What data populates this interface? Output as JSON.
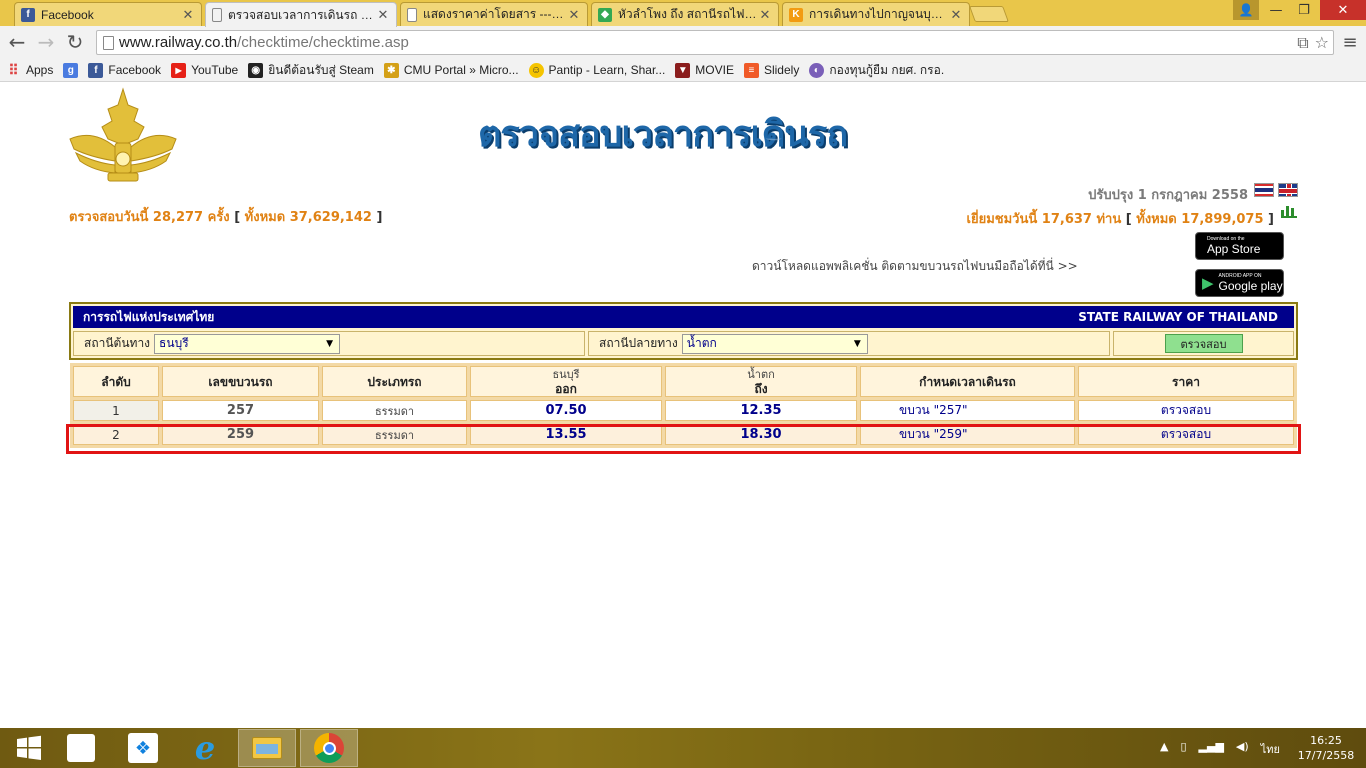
{
  "browser": {
    "tabs": [
      {
        "title": "Facebook",
        "icon": "facebook-icon",
        "color": "#3b5998",
        "glyph": "f"
      },
      {
        "title": "ตรวจสอบเวลาการเดินรถ การร",
        "icon": "page-icon",
        "color": "#ffffff",
        "glyph": ""
      },
      {
        "title": "แสดงราคาค่าโดยสาร ---> กา",
        "icon": "page-icon",
        "color": "#ffffff",
        "glyph": ""
      },
      {
        "title": "หัวลำโพง ถึง สถานีรถไฟธนบุรี",
        "icon": "maps-icon",
        "color": "#34a853",
        "glyph": "◆"
      },
      {
        "title": "การเดินทางไปกาญจนบุรี ด้วยร",
        "icon": "k-icon",
        "color": "#f29b12",
        "glyph": "K"
      }
    ],
    "url_host": "www.railway.co.th",
    "url_path": "/checktime/checktime.asp",
    "bookmarks": [
      {
        "label": "Apps",
        "icon": "apps-icon",
        "color": "#e44d26",
        "glyph": "⠿"
      },
      {
        "label": "",
        "icon": "google-plus-icon",
        "color": "#4a7be0",
        "glyph": "g"
      },
      {
        "label": "Facebook",
        "icon": "facebook-icon",
        "color": "#3b5998",
        "glyph": "f"
      },
      {
        "label": "YouTube",
        "icon": "youtube-icon",
        "color": "#e62117",
        "glyph": "▶"
      },
      {
        "label": "ยินดีต้อนรับสู่ Steam",
        "icon": "steam-icon",
        "color": "#222222",
        "glyph": "◉"
      },
      {
        "label": "CMU Portal » Micro...",
        "icon": "cmu-icon",
        "color": "#d4a017",
        "glyph": "✱"
      },
      {
        "label": "Pantip - Learn, Shar...",
        "icon": "pantip-icon",
        "color": "#f5c400",
        "glyph": "☺"
      },
      {
        "label": "MOVIE",
        "icon": "movie-icon",
        "color": "#8b1d1d",
        "glyph": "▼"
      },
      {
        "label": "Slidely",
        "icon": "slidely-icon",
        "color": "#f05a28",
        "glyph": "≡"
      },
      {
        "label": "กองทุนกู้ยืม กยศ. กรอ.",
        "icon": "fund-icon",
        "color": "#7a5fb8",
        "glyph": "◐"
      }
    ]
  },
  "page": {
    "banner": "ตรวจสอบเวลาการเดินรถ",
    "updated": "ปรับปรุง 1 กรกฎาคม 2558",
    "stats_left": {
      "prefix": "ตรวจสอบวันนี้ 28,277 ครั้ง",
      "total": "ทั้งหมด 37,629,142"
    },
    "stats_right": {
      "prefix": "เยี่ยมชมวันนี้ 17,637 ท่าน",
      "total": "ทั้งหมด 17,899,075"
    },
    "app_text": "ดาวน์โหลดแอพพลิเคชั่น ติดตามขบวนรถไฟบนมือถือได้ที่นี่ >>",
    "appstore": {
      "small": "Download on the",
      "big": "App Store"
    },
    "googleplay": {
      "small": "ANDROID APP ON",
      "big": "Google play"
    }
  },
  "panel": {
    "title_th": "การรถไฟแห่งประเทศไทย",
    "title_en": "STATE RAILWAY OF THAILAND",
    "origin_label": "สถานีต้นทาง",
    "origin_value": "ธนบุรี",
    "dest_label": "สถานีปลายทาง",
    "dest_value": "น้ำตก",
    "check_button": "ตรวจสอบ"
  },
  "table": {
    "headers": {
      "no": "ลำดับ",
      "train": "เลขขบวนรถ",
      "type": "ประเภทรถ",
      "depart_station": "ธนบุรี",
      "depart": "ออก",
      "arrive_station": "น้ำตก",
      "arrive": "ถึง",
      "schedule": "กำหนดเวลาเดินรถ",
      "price": "ราคา"
    },
    "rows": [
      {
        "no": "1",
        "train": "257",
        "type": "ธรรมดา",
        "depart": "07.50",
        "arrive": "12.35",
        "schedule": "ขบวน \"257\"",
        "price": "ตรวจสอบ"
      },
      {
        "no": "2",
        "train": "259",
        "type": "ธรรมดา",
        "depart": "13.55",
        "arrive": "18.30",
        "schedule": "ขบวน \"259\"",
        "price": "ตรวจสอบ"
      }
    ]
  },
  "taskbar": {
    "items": [
      "start-icon",
      "apps-grid-icon",
      "dropbox-icon",
      "internet-explorer-icon",
      "file-explorer-icon",
      "chrome-icon"
    ],
    "lang": "ไทย",
    "time": "16:25",
    "date": "17/7/2558"
  }
}
